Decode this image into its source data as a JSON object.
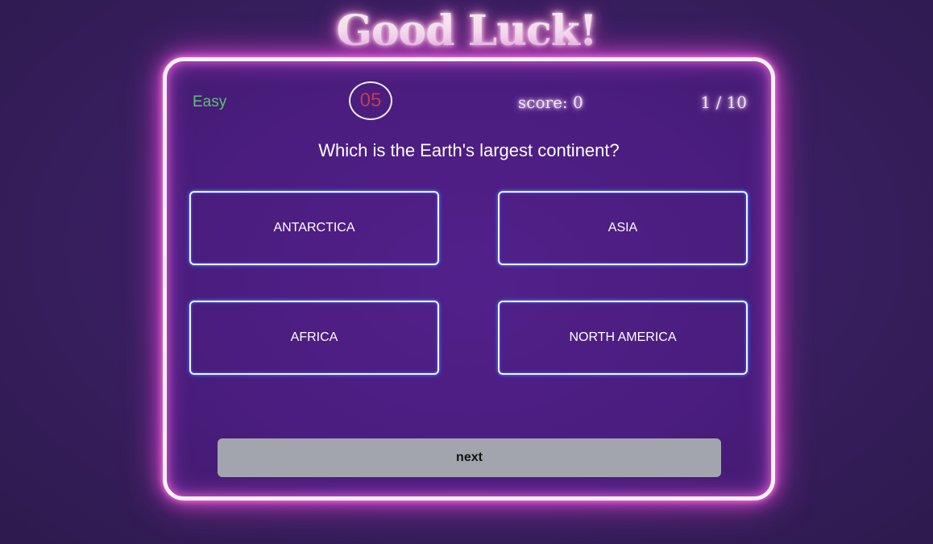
{
  "header": {
    "title": "Good Luck!"
  },
  "quiz": {
    "difficulty": "Easy",
    "timer": "05",
    "score": "score: 0",
    "progress": "1 / 10",
    "question": "Which is the Earth's largest continent?",
    "answers": [
      {
        "label": "ANTARCTICA"
      },
      {
        "label": "ASIA"
      },
      {
        "label": "AFRICA"
      },
      {
        "label": "NORTH AMERICA"
      }
    ],
    "next_label": "next"
  },
  "colors": {
    "background": "#3a1f63",
    "card_glow": "#e24bd0",
    "difficulty_easy": "#5fbf72",
    "timer_text": "#c83a4a",
    "answer_border_glow": "#4b76ff",
    "next_button": "#a2a5ad"
  }
}
